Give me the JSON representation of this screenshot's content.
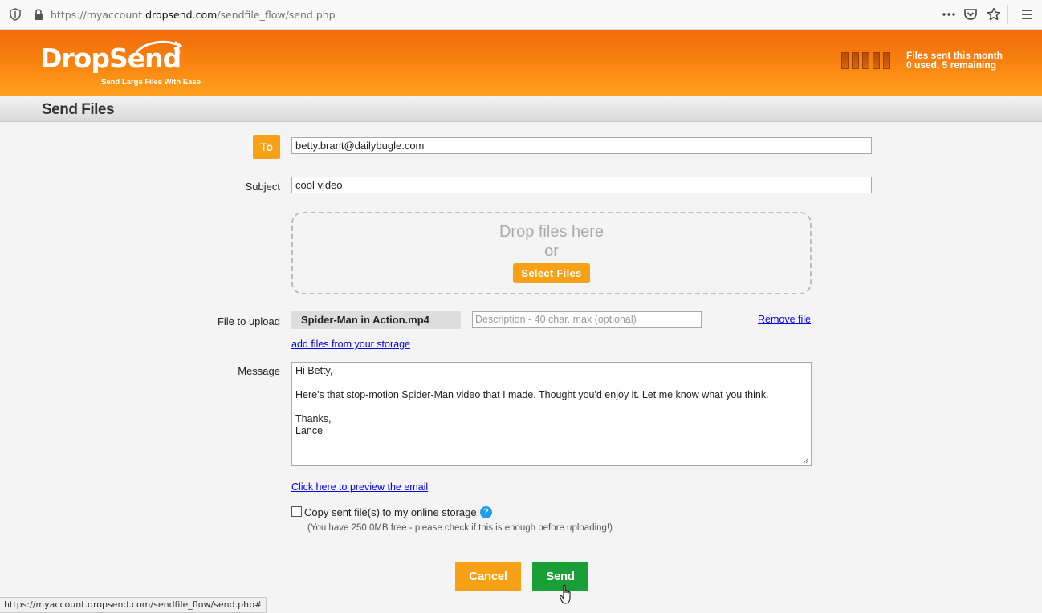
{
  "browser": {
    "url_prefix": "https://myaccount.",
    "url_domain": "dropsend.com",
    "url_path": "/sendfile_flow/send.php",
    "status_url": "https://myaccount.dropsend.com/sendfile_flow/send.php#"
  },
  "header": {
    "logo_name": "DropSend",
    "logo_reg": "®",
    "tagline": "Send Large Files With Ease",
    "quota_title": "Files sent this month",
    "quota_detail": "0 used, 5 remaining",
    "files_used": 0,
    "files_total": 5,
    "brand_color": "#f77d0f"
  },
  "page": {
    "title": "Send Files"
  },
  "form": {
    "to_label": "To",
    "to_value": "betty.brant@dailybugle.com",
    "subject_label": "Subject",
    "subject_value": "cool video",
    "drop_text": "Drop files here",
    "drop_or": "or",
    "select_files_label": "Select Files",
    "file_label": "File to upload",
    "file_name": "Spider-Man in Action.mp4",
    "description_placeholder": "Description - 40 char. max (optional)",
    "remove_file_label": "Remove file",
    "add_storage_label": "add files from your storage",
    "message_label": "Message",
    "message_value": "Hi Betty,\n\nHere's that stop-motion Spider-Man video that I made. Thought you'd enjoy it. Let me know what you think.\n\nThanks,\nLance",
    "preview_label": "Click here to preview the email",
    "copy_label": "Copy sent file(s) to my online storage",
    "copy_checked": false,
    "storage_note": "(You have 250.0MB free - please check if this is enough before uploading!)",
    "cancel_label": "Cancel",
    "send_label": "Send"
  },
  "colors": {
    "orange_button": "#f9a116",
    "send_button": "#1a9e38",
    "link": "#0000ee",
    "help": "#1e9ee8"
  }
}
